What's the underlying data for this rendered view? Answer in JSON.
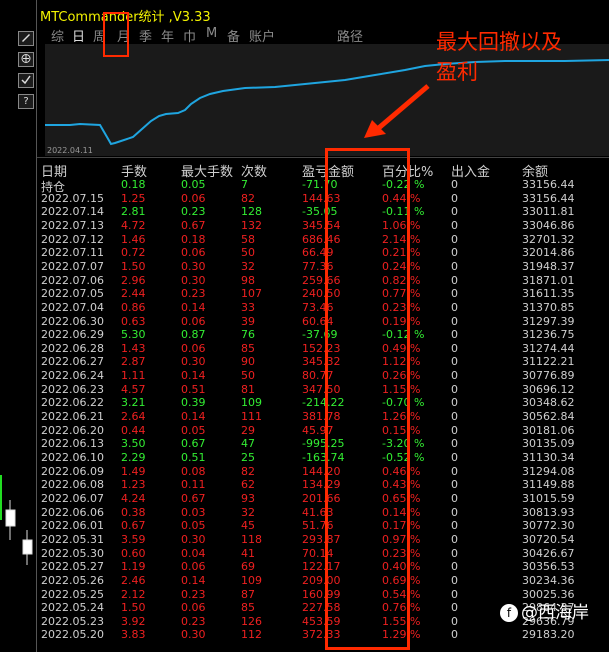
{
  "window": {
    "title": "MTCommander统计 ,V3.33"
  },
  "leftbar": {
    "buttons": [
      {
        "icon": "pencil-icon",
        "label": ""
      },
      {
        "icon": "compass-icon",
        "label": ""
      },
      {
        "icon": "checkmark-icon",
        "label": ""
      },
      {
        "icon": "help-icon",
        "label": "?"
      }
    ]
  },
  "tabs": [
    "综",
    "日",
    "周",
    "月",
    "季",
    "年",
    "巾",
    "M",
    "备",
    "账户",
    "路径"
  ],
  "chart": {
    "date_label": "2022.04.11"
  },
  "table": {
    "headers": [
      "日期",
      "手数",
      "最大手数",
      "次数",
      "盈亏金额",
      "百分比%",
      "出入金",
      "余额"
    ],
    "rows": [
      [
        "持仓",
        "0.18",
        "0.05",
        "7",
        "-71.70",
        "-0.22 %",
        "0",
        "33156.44"
      ],
      [
        "2022.07.15",
        "1.25",
        "0.06",
        "82",
        "144.63",
        "0.44 %",
        "0",
        "33156.44"
      ],
      [
        "2022.07.14",
        "2.81",
        "0.23",
        "128",
        "-35.05",
        "-0.11 %",
        "0",
        "33011.81"
      ],
      [
        "2022.07.13",
        "4.72",
        "0.67",
        "132",
        "345.54",
        "1.06 %",
        "0",
        "33046.86"
      ],
      [
        "2022.07.12",
        "1.46",
        "0.18",
        "58",
        "686.46",
        "2.14 %",
        "0",
        "32701.32"
      ],
      [
        "2022.07.11",
        "0.72",
        "0.06",
        "50",
        "66.49",
        "0.21 %",
        "0",
        "32014.86"
      ],
      [
        "2022.07.07",
        "1.50",
        "0.30",
        "32",
        "77.36",
        "0.24 %",
        "0",
        "31948.37"
      ],
      [
        "2022.07.06",
        "2.96",
        "0.30",
        "98",
        "259.66",
        "0.82 %",
        "0",
        "31871.01"
      ],
      [
        "2022.07.05",
        "2.44",
        "0.23",
        "107",
        "240.50",
        "0.77 %",
        "0",
        "31611.35"
      ],
      [
        "2022.07.04",
        "0.86",
        "0.14",
        "33",
        "73.46",
        "0.23 %",
        "0",
        "31370.85"
      ],
      [
        "2022.06.30",
        "0.63",
        "0.06",
        "39",
        "60.64",
        "0.19 %",
        "0",
        "31297.39"
      ],
      [
        "2022.06.29",
        "5.30",
        "0.87",
        "76",
        "-37.69",
        "-0.12 %",
        "0",
        "31236.75"
      ],
      [
        "2022.06.28",
        "1.43",
        "0.06",
        "85",
        "152.23",
        "0.49 %",
        "0",
        "31274.44"
      ],
      [
        "2022.06.27",
        "2.87",
        "0.30",
        "90",
        "345.32",
        "1.12 %",
        "0",
        "31122.21"
      ],
      [
        "2022.06.24",
        "1.11",
        "0.14",
        "50",
        "80.77",
        "0.26 %",
        "0",
        "30776.89"
      ],
      [
        "2022.06.23",
        "4.57",
        "0.51",
        "81",
        "347.50",
        "1.15 %",
        "0",
        "30696.12"
      ],
      [
        "2022.06.22",
        "3.21",
        "0.39",
        "109",
        "-214.22",
        "-0.70 %",
        "0",
        "30348.62"
      ],
      [
        "2022.06.21",
        "2.64",
        "0.14",
        "111",
        "381.78",
        "1.26 %",
        "0",
        "30562.84"
      ],
      [
        "2022.06.20",
        "0.44",
        "0.05",
        "29",
        "45.97",
        "0.15 %",
        "0",
        "30181.06"
      ],
      [
        "2022.06.13",
        "3.50",
        "0.67",
        "47",
        "-995.25",
        "-3.20 %",
        "0",
        "30135.09"
      ],
      [
        "2022.06.10",
        "2.29",
        "0.51",
        "25",
        "-163.74",
        "-0.52 %",
        "0",
        "31130.34"
      ],
      [
        "2022.06.09",
        "1.49",
        "0.08",
        "82",
        "144.20",
        "0.46 %",
        "0",
        "31294.08"
      ],
      [
        "2022.06.08",
        "1.23",
        "0.11",
        "62",
        "134.29",
        "0.43 %",
        "0",
        "31149.88"
      ],
      [
        "2022.06.07",
        "4.24",
        "0.67",
        "93",
        "201.66",
        "0.65 %",
        "0",
        "31015.59"
      ],
      [
        "2022.06.06",
        "0.38",
        "0.03",
        "32",
        "41.63",
        "0.14 %",
        "0",
        "30813.93"
      ],
      [
        "2022.06.01",
        "0.67",
        "0.05",
        "45",
        "51.76",
        "0.17 %",
        "0",
        "30772.30"
      ],
      [
        "2022.05.31",
        "3.59",
        "0.30",
        "118",
        "293.87",
        "0.97 %",
        "0",
        "30720.54"
      ],
      [
        "2022.05.30",
        "0.60",
        "0.04",
        "41",
        "70.14",
        "0.23 %",
        "0",
        "30426.67"
      ],
      [
        "2022.05.27",
        "1.19",
        "0.06",
        "69",
        "122.17",
        "0.40 %",
        "0",
        "30356.53"
      ],
      [
        "2022.05.26",
        "2.46",
        "0.14",
        "109",
        "209.00",
        "0.69 %",
        "0",
        "30234.36"
      ],
      [
        "2022.05.25",
        "2.12",
        "0.23",
        "87",
        "160.99",
        "0.54 %",
        "0",
        "30025.36"
      ],
      [
        "2022.05.24",
        "1.50",
        "0.06",
        "85",
        "227.58",
        "0.76 %",
        "0",
        "29864.37"
      ],
      [
        "2022.05.23",
        "3.92",
        "0.23",
        "126",
        "453.59",
        "1.55 %",
        "0",
        "29636.79"
      ],
      [
        "2022.05.20",
        "3.83",
        "0.30",
        "112",
        "372.33",
        "1.29 %",
        "0",
        "29183.20"
      ]
    ]
  },
  "annotation": {
    "line1": "最大回撤以及",
    "line2": "盈利"
  },
  "watermark": {
    "icon": "f",
    "text": "@西海岸"
  },
  "colors": {
    "profit": "#ee2020",
    "loss": "#33ee33",
    "highlight": "#ff2a00",
    "title": "#f4f400",
    "equity_line": "#1fa5e0"
  }
}
